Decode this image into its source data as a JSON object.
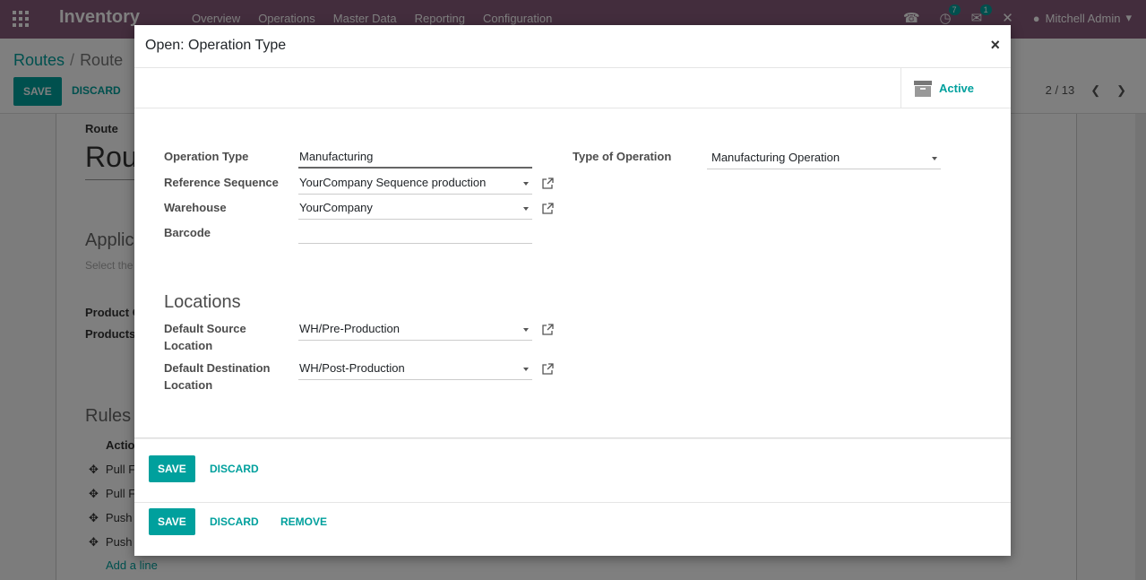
{
  "navbar": {
    "brand": "Inventory",
    "menu": [
      "Overview",
      "Operations",
      "Master Data",
      "Reporting",
      "Configuration"
    ],
    "activity_badge": "7",
    "messages_badge": "1",
    "user": "Mitchell Admin"
  },
  "control_panel": {
    "breadcrumb_parent": "Routes",
    "breadcrumb_current": "Route",
    "save_label": "SAVE",
    "discard_label": "DISCARD",
    "pager": "2 / 13"
  },
  "background_form": {
    "route_label": "Route",
    "route_name": "Rou",
    "applicable_title": "Applic",
    "select_text": "Select the",
    "product_categories_label": "Product C",
    "products_label": "Products",
    "rules_title": "Rules",
    "action_col": "Actio",
    "rules": [
      "Pull F",
      "Pull F",
      "Push",
      "Push"
    ],
    "add_line": "Add a line"
  },
  "modal": {
    "title": "Open: Operation Type",
    "close": "×",
    "active_label": "Active",
    "fields": {
      "operation_type_label": "Operation Type",
      "operation_type_value": "Manufacturing",
      "reference_sequence_label": "Reference Sequence",
      "reference_sequence_value": "YourCompany Sequence production",
      "warehouse_label": "Warehouse",
      "warehouse_value": "YourCompany",
      "barcode_label": "Barcode",
      "barcode_value": "",
      "type_of_operation_label": "Type of Operation",
      "type_of_operation_value": "Manufacturing Operation"
    },
    "locations_title": "Locations",
    "locations": {
      "source_label_1": "Default Source",
      "source_label_2": "Location",
      "source_value": "WH/Pre-Production",
      "dest_label_1": "Default Destination",
      "dest_label_2": "Location",
      "dest_value": "WH/Post-Production"
    },
    "inner_footer": {
      "save": "SAVE",
      "discard": "DISCARD"
    },
    "outer_footer": {
      "save": "SAVE",
      "discard": "DISCARD",
      "remove": "REMOVE"
    }
  },
  "colors": {
    "brand": "#875a7b",
    "accent": "#00a09d"
  }
}
